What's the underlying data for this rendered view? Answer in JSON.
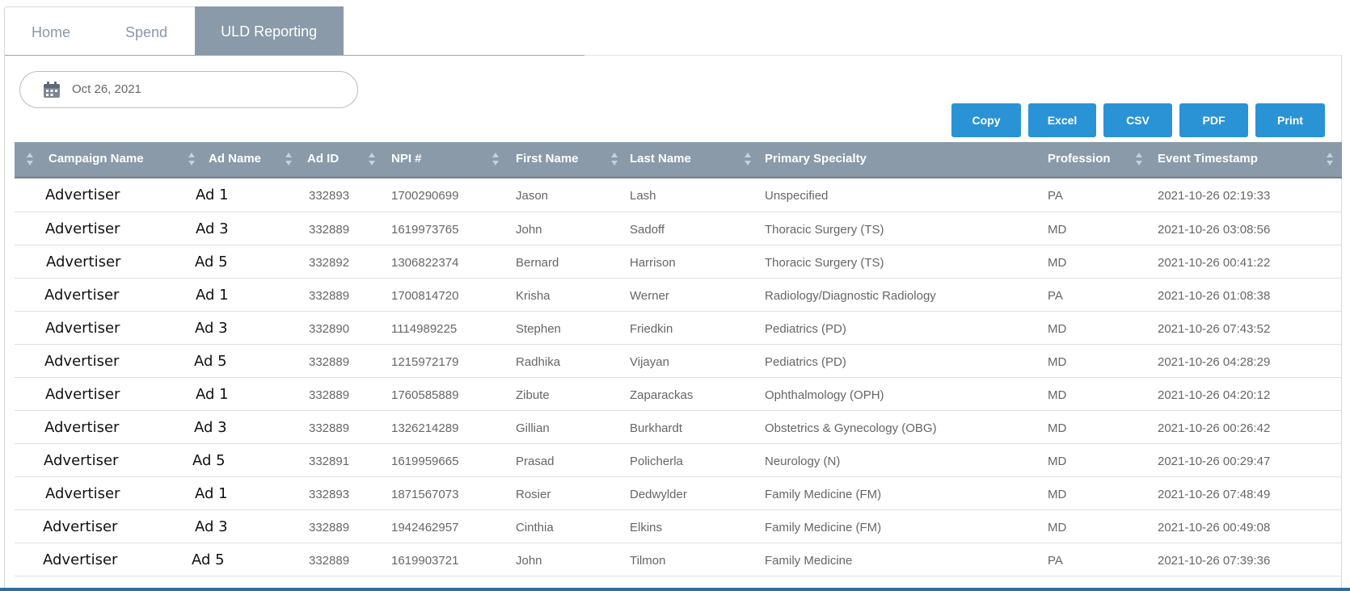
{
  "tabs": [
    {
      "label": "Home"
    },
    {
      "label": "Spend"
    },
    {
      "label": "ULD Reporting"
    }
  ],
  "date_picker": {
    "value": "Oct 26, 2021",
    "icon": "calendar-icon"
  },
  "export_buttons": [
    {
      "label": "Copy"
    },
    {
      "label": "Excel"
    },
    {
      "label": "CSV"
    },
    {
      "label": "PDF"
    },
    {
      "label": "Print"
    }
  ],
  "table": {
    "columns": [
      "Campaign Name",
      "Ad Name",
      "Ad ID",
      "NPI #",
      "First Name",
      "Last Name",
      "Primary Specialty",
      "Profession",
      "Event Timestamp"
    ],
    "rows": [
      [
        "Advertiser",
        "Ad 1",
        "332893",
        "1700290699",
        "Jason",
        "Lash",
        "Unspecified",
        "PA",
        "2021-10-26 02:19:33"
      ],
      [
        "Advertiser",
        "Ad 3",
        "332889",
        "1619973765",
        "John",
        "Sadoff",
        "Thoracic Surgery (TS)",
        "MD",
        "2021-10-26 03:08:56"
      ],
      [
        "Advertiser",
        "Ad 5",
        "332892",
        "1306822374",
        "Bernard",
        "Harrison",
        "Thoracic Surgery (TS)",
        "MD",
        "2021-10-26 00:41:22"
      ],
      [
        "Advertiser",
        "Ad 1",
        "332889",
        "1700814720",
        "Krisha",
        "Werner",
        "Radiology/Diagnostic Radiology",
        "PA",
        "2021-10-26 01:08:38"
      ],
      [
        "Advertiser",
        "Ad 3",
        "332890",
        "1114989225",
        "Stephen",
        "Friedkin",
        "Pediatrics (PD)",
        "MD",
        "2021-10-26 07:43:52"
      ],
      [
        "Advertiser",
        "Ad 5",
        "332889",
        "1215972179",
        "Radhika",
        "Vijayan",
        "Pediatrics (PD)",
        "MD",
        "2021-10-26 04:28:29"
      ],
      [
        "Advertiser",
        "Ad 1",
        "332889",
        "1760585889",
        "Zibute",
        "Zaparackas",
        "Ophthalmology (OPH)",
        "MD",
        "2021-10-26 04:20:12"
      ],
      [
        "Advertiser",
        "Ad 3",
        "332889",
        "1326214289",
        "Gillian",
        "Burkhardt",
        "Obstetrics & Gynecology (OBG)",
        "MD",
        "2021-10-26 00:26:42"
      ],
      [
        "Advertiser",
        "Ad 5",
        "332891",
        "1619959665",
        "Prasad",
        "Policherla",
        "Neurology (N)",
        "MD",
        "2021-10-26 00:29:47"
      ],
      [
        "Advertiser",
        "Ad 1",
        "332893",
        "1871567073",
        "Rosier",
        "Dedwylder",
        "Family Medicine (FM)",
        "MD",
        "2021-10-26 07:48:49"
      ],
      [
        "Advertiser",
        "Ad 3",
        "332889",
        "1942462957",
        "Cinthia",
        "Elkins",
        "Family Medicine (FM)",
        "MD",
        "2021-10-26 00:49:08"
      ],
      [
        "Advertiser",
        "Ad 5",
        "332889",
        "1619903721",
        "John",
        "Tilmon",
        "Family Medicine",
        "PA",
        "2021-10-26 07:39:36"
      ]
    ]
  }
}
